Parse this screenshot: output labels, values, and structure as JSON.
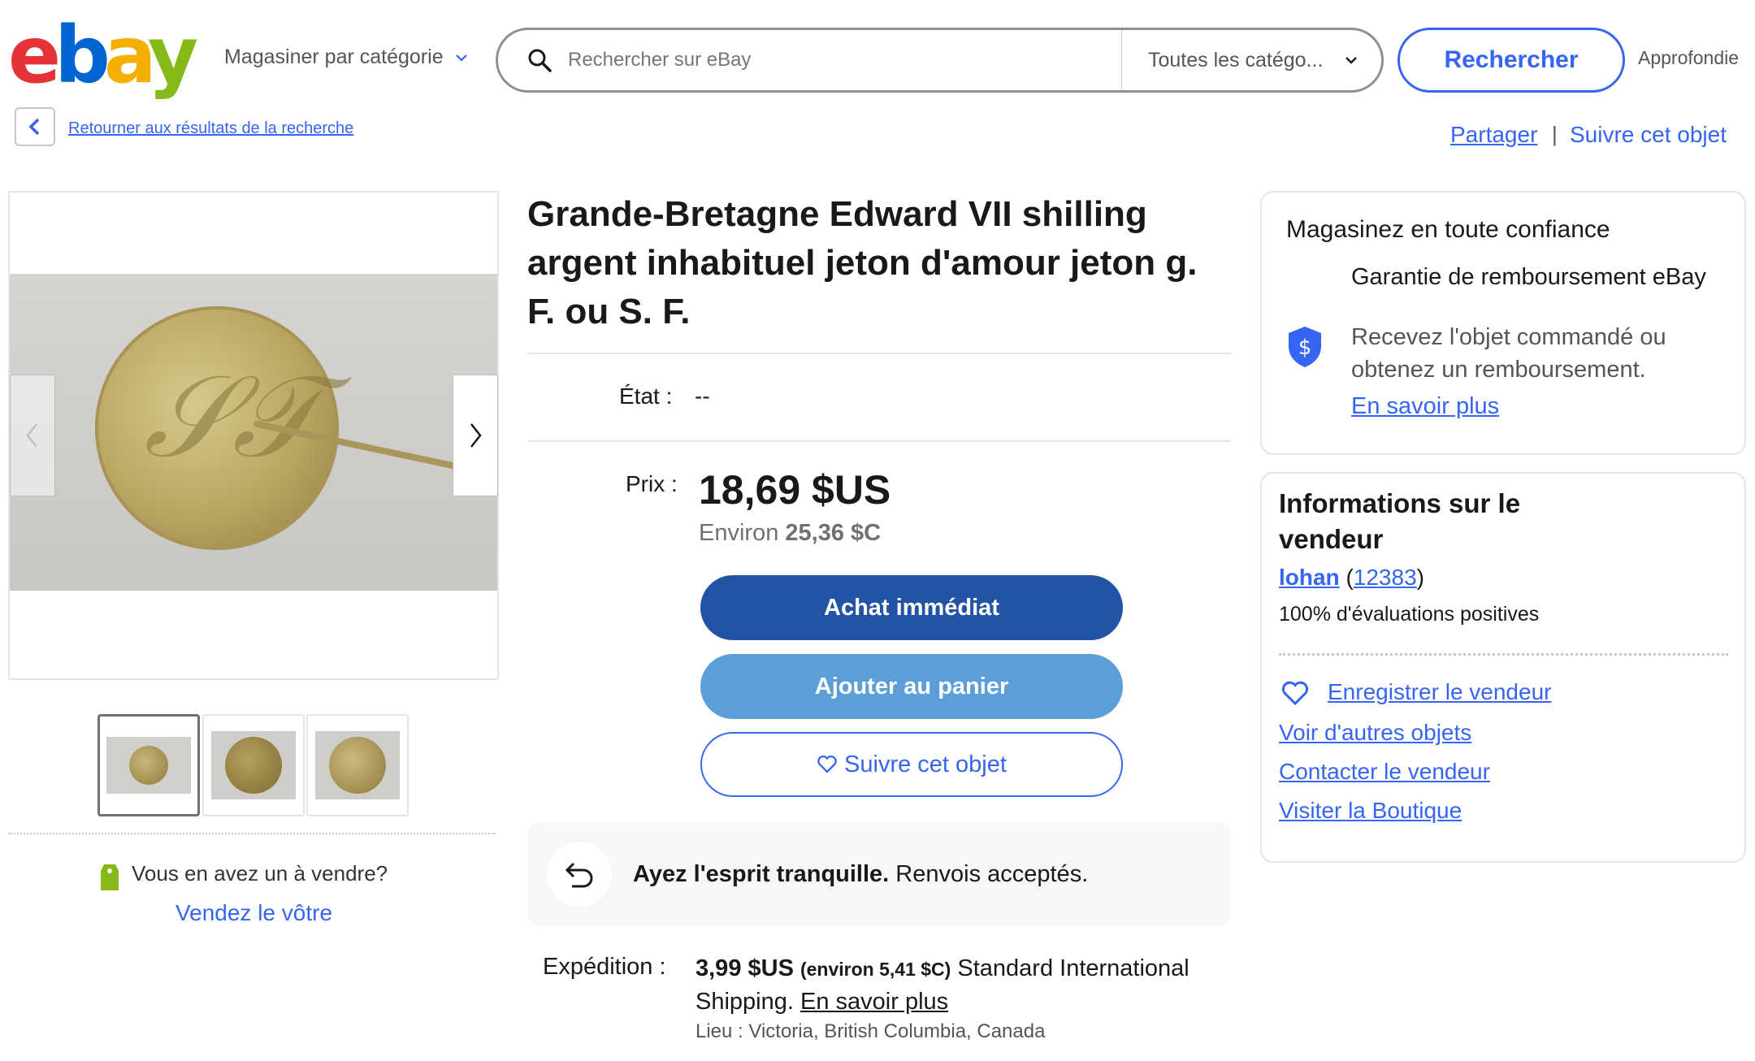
{
  "header": {
    "logo_letters": [
      "e",
      "b",
      "a",
      "y"
    ],
    "shop_by_category": "Magasiner par catégorie",
    "search_placeholder": "Rechercher sur eBay",
    "category_select": "Toutes les catégo...",
    "search_button": "Rechercher",
    "advanced": "Approfondie"
  },
  "nav": {
    "back_link": "Retourner aux résultats de la recherche",
    "share": "Partager",
    "separator": "|",
    "follow": "Suivre cet objet"
  },
  "gallery": {
    "thumbnails": 3,
    "active_thumbnail": 1,
    "sell_question": "Vous en avez un à vendre?",
    "sell_link": "Vendez le vôtre"
  },
  "item": {
    "title": "Grande-Bretagne Edward VII shilling argent inhabituel jeton d'amour jeton g. F. ou S. F.",
    "condition_label": "État :",
    "condition_value": "--",
    "price_label": "Prix :",
    "price": "18,69 $US",
    "approx_prefix": "Environ",
    "approx_value": "25,36 $C",
    "buy_now": "Achat immédiat",
    "add_to_cart": "Ajouter au panier",
    "watch": "Suivre cet objet",
    "returns_bold": "Ayez l'esprit tranquille.",
    "returns_text": " Renvois acceptés.",
    "shipping_label": "Expédition :",
    "shipping_price": "3,99 $US",
    "shipping_approx": "(environ 5,41 $C)",
    "shipping_service": " Standard International Shipping.",
    "shipping_more": "En savoir plus",
    "location": "Lieu : Victoria, British Columbia, Canada"
  },
  "trust": {
    "title": "Magasinez en toute confiance",
    "heading": "Garantie de remboursement eBay",
    "description": "Recevez l'objet commandé ou obtenez un remboursement.",
    "link": "En savoir plus"
  },
  "seller": {
    "title": "Informations sur le vendeur",
    "name": "lohan",
    "feedback_open": " (",
    "feedback_score": "12383",
    "feedback_close": ")",
    "positive": "100% d'évaluations positives",
    "save_seller": "Enregistrer le vendeur",
    "other_items": "Voir d'autres objets",
    "contact": "Contacter le vendeur",
    "store": "Visiter la Boutique"
  },
  "colors": {
    "accent": "#3665f3",
    "buy_button": "#2353a5",
    "cart_button": "#5c9fd8"
  },
  "icons": [
    "search-icon",
    "chevron-down-icon",
    "chevron-left-icon",
    "chevron-right-icon",
    "heart-icon",
    "return-arrow-icon",
    "shield-dollar-icon",
    "price-tag-icon"
  ]
}
